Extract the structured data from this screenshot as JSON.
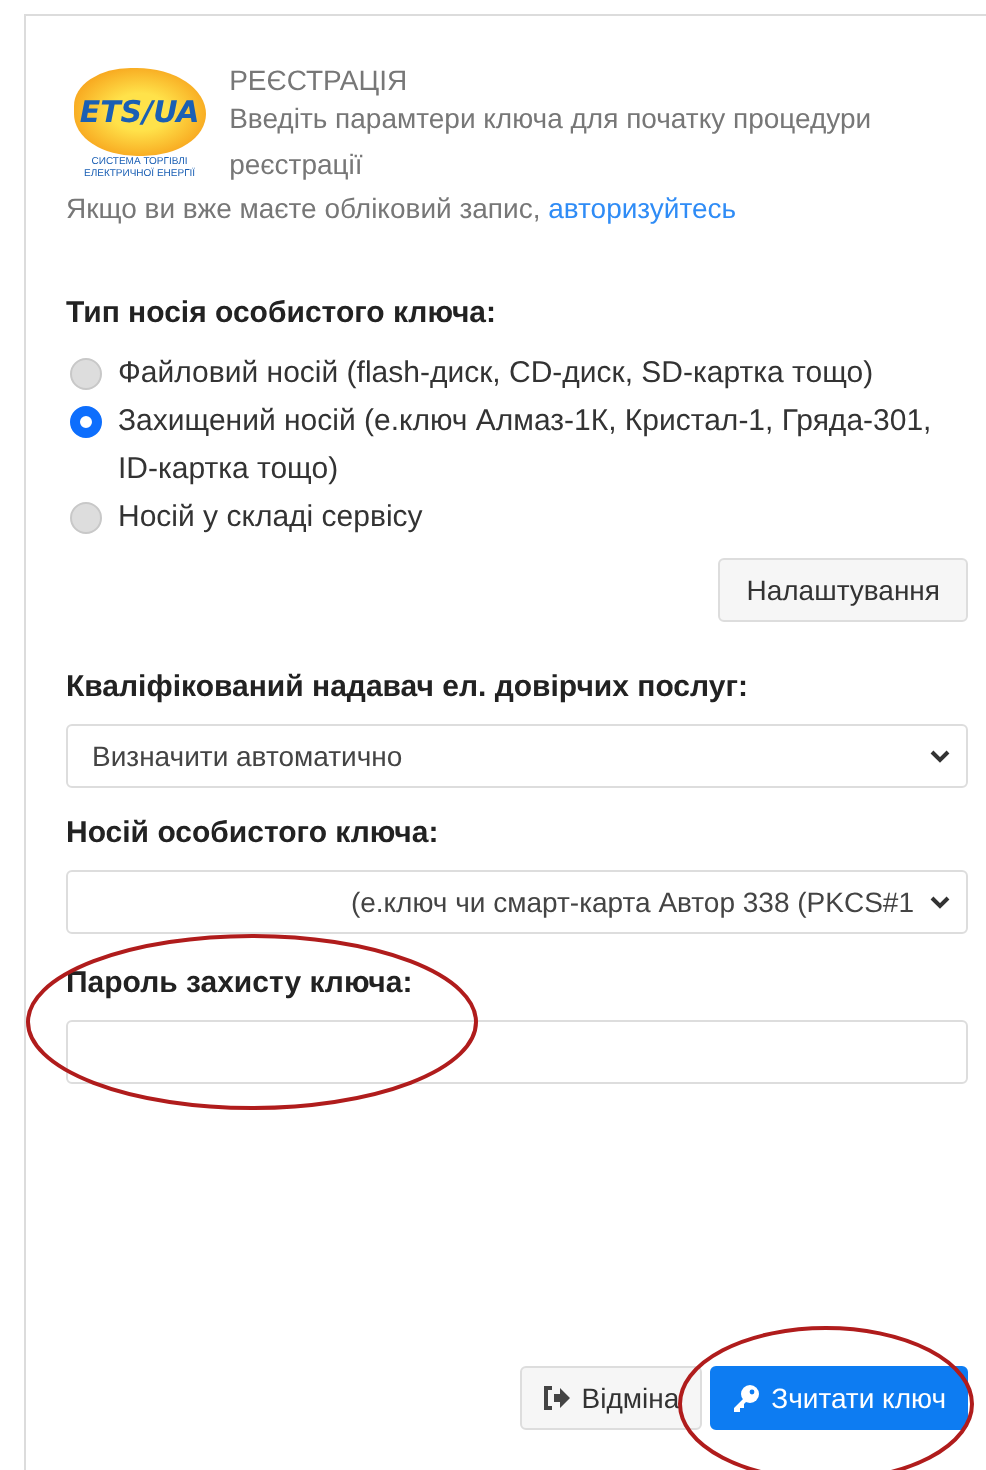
{
  "header": {
    "logo": {
      "word": "ETS/UA",
      "line_1": "СИСТЕМА ТОРГІВЛІ",
      "line_2": "ЕЛЕКТРИЧНОЇ ЕНЕРГІЇ"
    },
    "title": "РЕЄСТРАЦІЯ",
    "subtitle": "Введіть парамтери ключа для початку процедури реєстрації",
    "login_prompt": "Якщо ви вже маєте обліковий запис,",
    "login_link": "авторизуйтесь"
  },
  "key_media_type": {
    "label": "Тип носія особистого ключа:",
    "options": [
      {
        "label": "Файловий носій (flash-диск, CD-диск, SD-картка тощо)",
        "selected": false
      },
      {
        "label": "Захищений носій (е.ключ Алмаз-1К, Кристал-1, Гряда-301, ID-картка тощо)",
        "selected": true
      },
      {
        "label": "Носій у складі сервісу",
        "selected": false
      }
    ],
    "settings_button": "Налаштування"
  },
  "provider": {
    "label": "Кваліфікований надавач ел. довірчих послуг:",
    "value": "Визначити автоматично"
  },
  "key_media": {
    "label": "Носій особистого ключа:",
    "value": "(е.ключ чи смарт-карта Автор 338 (PKCS#1"
  },
  "password": {
    "label": "Пароль захисту ключа:"
  },
  "buttons": [
    {
      "kind": "secondary",
      "label": "Відміна"
    },
    {
      "kind": "primary",
      "label": "Зчитати ключ"
    }
  ],
  "annotations": [
    {
      "kind": "ellipse"
    },
    {
      "kind": "ellipse"
    }
  ]
}
